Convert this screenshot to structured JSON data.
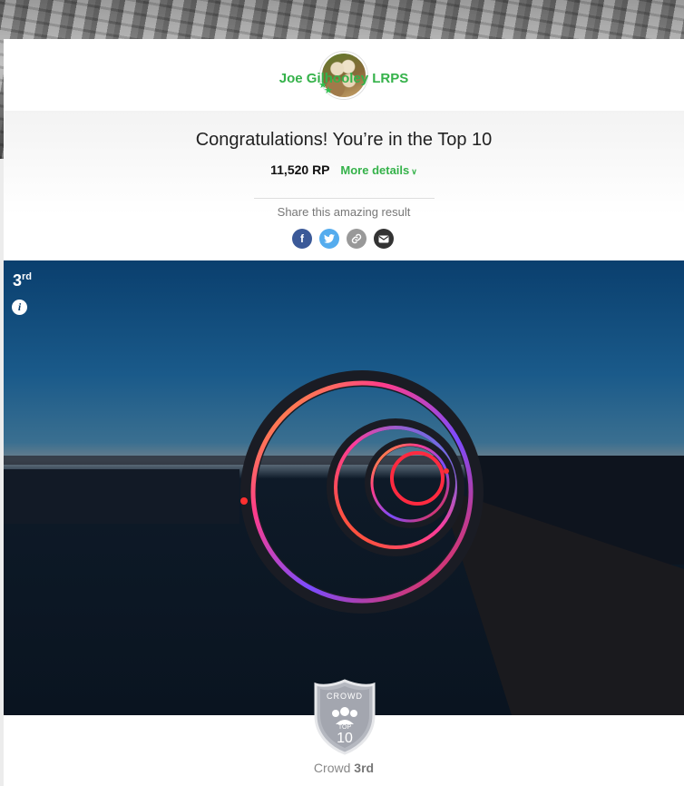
{
  "profile": {
    "name": "Joe Gilhooley LRPS",
    "avatar_icon": "avatar-owls",
    "star_icon": "star-icon"
  },
  "result": {
    "headline": "Congratulations! You’re in the Top 10",
    "points": "11,520 RP",
    "more_details": "More details",
    "more_details_icon": "chevron-down-icon",
    "share_label": "Share this amazing result"
  },
  "share": [
    {
      "name": "facebook",
      "glyph": "f",
      "color": "#3b5998"
    },
    {
      "name": "twitter",
      "glyph": "🐦",
      "color": "#55acee"
    },
    {
      "name": "link",
      "glyph": "🔗",
      "color": "#999999"
    },
    {
      "name": "email",
      "glyph": "✉",
      "color": "#333333"
    }
  ],
  "photo": {
    "rank": "3",
    "rank_suffix": "rd",
    "info_glyph": "i"
  },
  "crowd": {
    "badge_top": "CROWD",
    "badge_mid": "TOP",
    "badge_num": "10",
    "label": "Crowd",
    "rank": "3rd"
  },
  "colors": {
    "accent_green": "#35b24a"
  }
}
